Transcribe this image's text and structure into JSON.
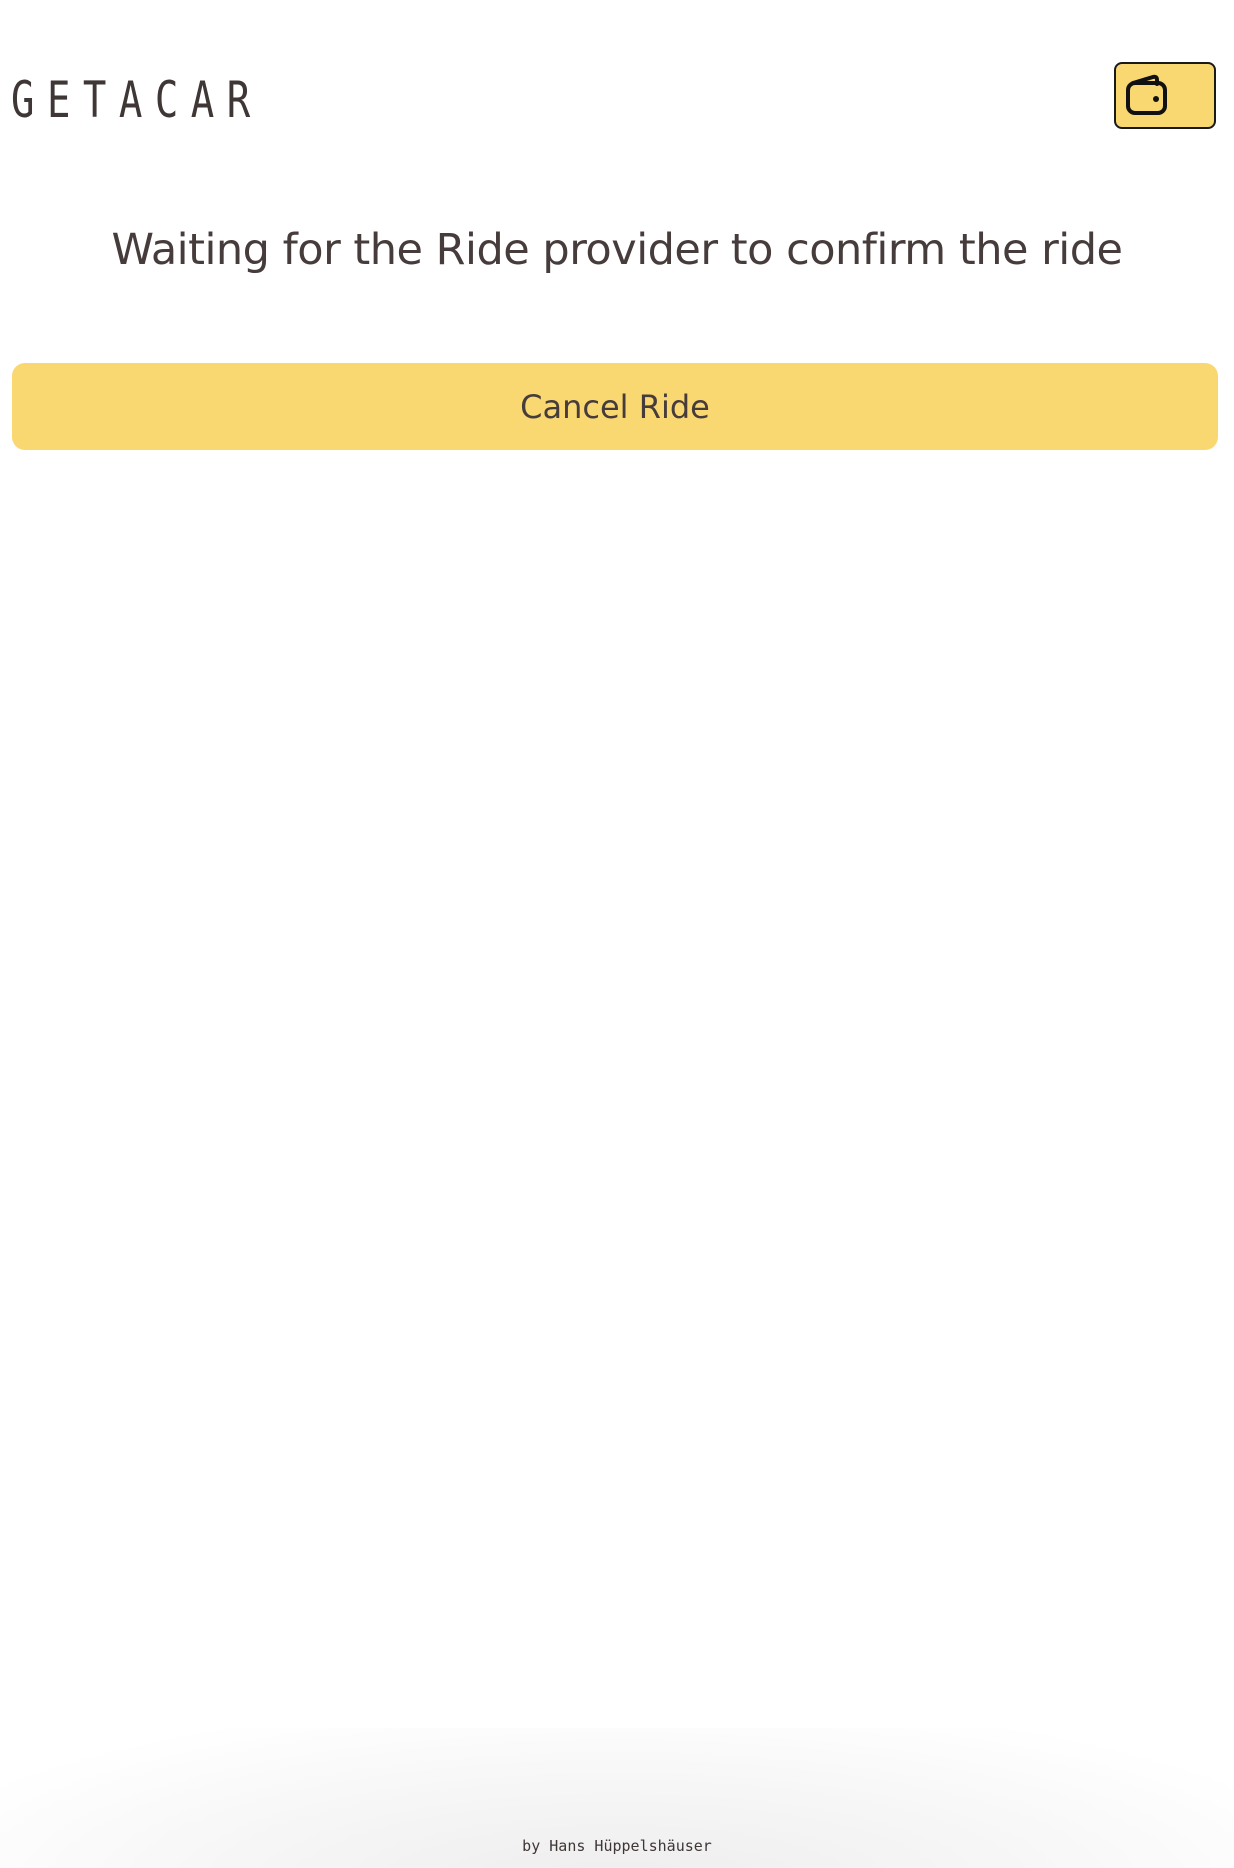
{
  "app": {
    "logo_text": "GETACAR"
  },
  "header": {
    "wallet_button": {
      "icon": "wallet-icon"
    }
  },
  "main": {
    "status_title": "Waiting for the Ride provider to confirm the ride",
    "cancel_button_label": "Cancel Ride"
  },
  "footer": {
    "credit": "by Hans Hüppelshäuser"
  },
  "colors": {
    "accent": "#f9d871",
    "text": "#473c3c",
    "background": "#ffffff",
    "border": "#1a1a1a"
  }
}
